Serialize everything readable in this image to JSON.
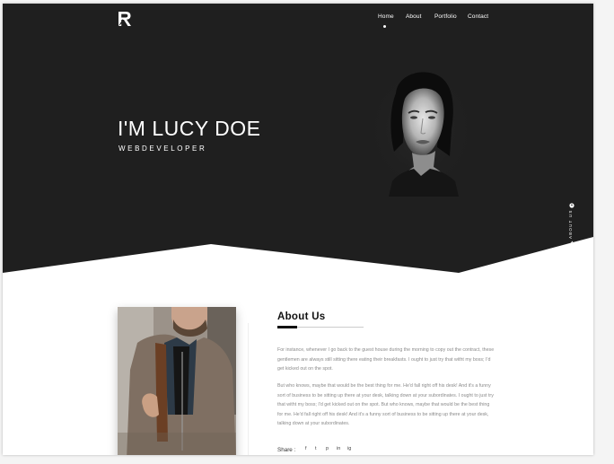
{
  "nav": {
    "items": [
      "Home",
      "About",
      "Portfolio",
      "Contact"
    ],
    "active": "Home"
  },
  "hero": {
    "title": "I'M LUCY DOE",
    "subtitle": "WEBDEVELOPER",
    "side_link": "ABOUT US"
  },
  "about": {
    "title": "About Us",
    "paragraph1": "For instance, whenever I go back to the guest house during the morning to copy out the contract, these gentlemen are always still sitting there eating their breakfasts. I ought to just try that witht my boss; I'd get kicked out on the spot.",
    "paragraph2": "But who knows, maybe that would be the best thing for me. He'd fall right off his desk! And it's a funny sort of business to be sitting up there at your desk, talking down at your subordinates. I ought to just try that witht my boss; I'd get kicked out on the spot. But who knows, maybe that would be the best thing for me. He'd fall right off his desk! And it's a funny sort of business to be sitting up there at your desk, talking down at your subordinates.",
    "share_label": "Share :",
    "share_icons": [
      "f",
      "t",
      "p",
      "in",
      "ig"
    ]
  },
  "colors": {
    "hero_bg": "#1f1f1f",
    "accent": "#111111",
    "text_muted": "#8a8a8a"
  }
}
